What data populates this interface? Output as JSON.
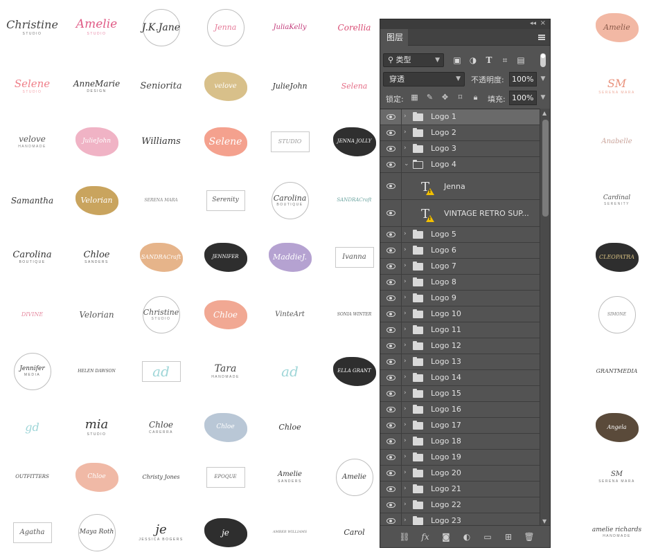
{
  "colors": {
    "panel_bg": "#535353",
    "panel_dark": "#3a3a3a",
    "selected_row": "#6a6a6a",
    "text": "#e3e3e3",
    "warning": "#f3c000"
  },
  "panel": {
    "tab_label": "图层",
    "filter": {
      "kind_label": "类型",
      "icons": [
        "image-filter-icon",
        "adjustment-filter-icon",
        "type-filter-icon",
        "shape-filter-icon",
        "smart-object-filter-icon"
      ]
    },
    "blend_mode": "穿透",
    "opacity_label": "不透明度:",
    "opacity_value": "100%",
    "lock_label": "锁定:",
    "fill_label": "填充:",
    "fill_value": "100%",
    "layers": [
      {
        "name": "Logo 1",
        "kind": "group",
        "expanded": false,
        "selected": true
      },
      {
        "name": "Logo 2",
        "kind": "group",
        "expanded": false
      },
      {
        "name": "Logo 3",
        "kind": "group",
        "expanded": false
      },
      {
        "name": "Logo 4",
        "kind": "group",
        "expanded": true
      },
      {
        "name": "Jenna",
        "kind": "text",
        "warning": true
      },
      {
        "name": "VINTAGE RETRO SUP...",
        "kind": "text",
        "warning": true
      },
      {
        "name": "Logo 5",
        "kind": "group",
        "expanded": false
      },
      {
        "name": "Logo 6",
        "kind": "group",
        "expanded": false
      },
      {
        "name": "Logo 7",
        "kind": "group",
        "expanded": false
      },
      {
        "name": "Logo 8",
        "kind": "group",
        "expanded": false
      },
      {
        "name": "Logo 9",
        "kind": "group",
        "expanded": false
      },
      {
        "name": "Logo 10",
        "kind": "group",
        "expanded": false
      },
      {
        "name": "Logo 11",
        "kind": "group",
        "expanded": false
      },
      {
        "name": "Logo 12",
        "kind": "group",
        "expanded": false
      },
      {
        "name": "Logo 13",
        "kind": "group",
        "expanded": false
      },
      {
        "name": "Logo 14",
        "kind": "group",
        "expanded": false
      },
      {
        "name": "Logo 15",
        "kind": "group",
        "expanded": false
      },
      {
        "name": "Logo 16",
        "kind": "group",
        "expanded": false
      },
      {
        "name": "Logo 17",
        "kind": "group",
        "expanded": false
      },
      {
        "name": "Logo 18",
        "kind": "group",
        "expanded": false
      },
      {
        "name": "Logo 19",
        "kind": "group",
        "expanded": false
      },
      {
        "name": "Logo 20",
        "kind": "group",
        "expanded": false
      },
      {
        "name": "Logo 21",
        "kind": "group",
        "expanded": false
      },
      {
        "name": "Logo 22",
        "kind": "group",
        "expanded": false
      },
      {
        "name": "Logo 23",
        "kind": "group",
        "expanded": false
      }
    ],
    "footer_buttons": [
      "link-layers-icon",
      "fx-icon",
      "add-mask-icon",
      "adjustment-layer-icon",
      "new-group-icon",
      "new-layer-icon",
      "trash-icon"
    ]
  },
  "logos": [
    {
      "text": "Christine",
      "sub": "STUDIO",
      "color": "#444444",
      "size": 16,
      "row": 0,
      "col": 0
    },
    {
      "text": "Amelie",
      "sub": "STUDIO",
      "color": "#e05b86",
      "size": 17,
      "row": 0,
      "col": 1
    },
    {
      "text": "J.K.Jane",
      "sub": "",
      "color": "#333333",
      "size": 14,
      "row": 0,
      "col": 2,
      "ring": true
    },
    {
      "text": "Jenna",
      "sub": "",
      "color": "#e57a98",
      "size": 11,
      "row": 0,
      "col": 3,
      "ring": true
    },
    {
      "text": "JuliaKelly",
      "sub": "",
      "color": "#c23b7a",
      "size": 10,
      "row": 0,
      "col": 4
    },
    {
      "text": "Corellia",
      "sub": "",
      "color": "#d94b73",
      "size": 12,
      "row": 0,
      "col": 5
    },
    {
      "text": "Amelie",
      "sub": "",
      "color": "#8a5a4a",
      "size": 11,
      "row": 0,
      "col": 9,
      "blob": "#f2b8a4"
    },
    {
      "text": "Selene",
      "sub": "STUDIO",
      "color": "#ef7e88",
      "size": 15,
      "row": 1,
      "col": 0
    },
    {
      "text": "AnneMarie",
      "sub": "DESIGN",
      "color": "#333333",
      "size": 12,
      "row": 1,
      "col": 1
    },
    {
      "text": "Seniorita",
      "sub": "",
      "color": "#444444",
      "size": 13,
      "row": 1,
      "col": 2
    },
    {
      "text": "velove",
      "sub": "",
      "color": "#ffffff",
      "size": 10,
      "row": 1,
      "col": 3,
      "blob": "#d8c08a"
    },
    {
      "text": "JulieJohn",
      "sub": "",
      "color": "#333333",
      "size": 11,
      "row": 1,
      "col": 4
    },
    {
      "text": "Selena",
      "sub": "",
      "color": "#e56d86",
      "size": 11,
      "row": 1,
      "col": 5
    },
    {
      "text": "SM",
      "sub": "SERENA MARA",
      "color": "#e9927d",
      "size": 16,
      "row": 1,
      "col": 9
    },
    {
      "text": "velove",
      "sub": "HANDMADE",
      "color": "#555555",
      "size": 12,
      "row": 2,
      "col": 0
    },
    {
      "text": "JulieJohn",
      "sub": "",
      "color": "#ffffff",
      "size": 9,
      "row": 2,
      "col": 1,
      "blob": "#f0b3c5"
    },
    {
      "text": "Williams",
      "sub": "",
      "color": "#333333",
      "size": 13,
      "row": 2,
      "col": 2
    },
    {
      "text": "Selene",
      "sub": "",
      "color": "#ffffff",
      "size": 14,
      "row": 2,
      "col": 3,
      "blob": "#f4a18e"
    },
    {
      "text": "STUDIO",
      "sub": "",
      "color": "#9a9a9a",
      "size": 8,
      "row": 2,
      "col": 4,
      "box": true
    },
    {
      "text": "JENNA JOLLY",
      "sub": "",
      "color": "#ffffff",
      "size": 7,
      "row": 2,
      "col": 5,
      "blob": "#2f2f2f"
    },
    {
      "text": "Anabelle",
      "sub": "",
      "color": "#c9a39a",
      "size": 10,
      "row": 2,
      "col": 9
    },
    {
      "text": "Samantha",
      "sub": "",
      "color": "#333333",
      "size": 12,
      "row": 3,
      "col": 0
    },
    {
      "text": "Velorian",
      "sub": "",
      "color": "#ffffff",
      "size": 11,
      "row": 3,
      "col": 1,
      "blob": "#c9a45e"
    },
    {
      "text": "SERENA MARA",
      "sub": "",
      "color": "#7a7a7a",
      "size": 6,
      "row": 3,
      "col": 2
    },
    {
      "text": "Serenity",
      "sub": "",
      "color": "#555555",
      "size": 9,
      "row": 3,
      "col": 3,
      "box": true
    },
    {
      "text": "Carolina",
      "sub": "BOUTIQUE",
      "color": "#444444",
      "size": 11,
      "row": 3,
      "col": 4,
      "ring": true
    },
    {
      "text": "SANDRACraft",
      "sub": "",
      "color": "#6aa39f",
      "size": 7,
      "row": 3,
      "col": 5
    },
    {
      "text": "Cardinal",
      "sub": "SERENITY",
      "color": "#555555",
      "size": 9,
      "row": 3,
      "col": 9
    },
    {
      "text": "Carolina",
      "sub": "BOUTIQUE",
      "color": "#333333",
      "size": 13,
      "row": 4,
      "col": 0
    },
    {
      "text": "Chloe",
      "sub": "SANDERS",
      "color": "#333333",
      "size": 13,
      "row": 4,
      "col": 1
    },
    {
      "text": "SANDRACraft",
      "sub": "",
      "color": "#ffffff",
      "size": 8,
      "row": 4,
      "col": 2,
      "blob": "#e6b48a"
    },
    {
      "text": "JENNIFER",
      "sub": "",
      "color": "#ffffff",
      "size": 7,
      "row": 4,
      "col": 3,
      "blob": "#2e2e2e"
    },
    {
      "text": "MaddieJ.",
      "sub": "",
      "color": "#ffffff",
      "size": 11,
      "row": 4,
      "col": 4,
      "blob": "#b5a2d1"
    },
    {
      "text": "Ivanna",
      "sub": "",
      "color": "#555555",
      "size": 10,
      "row": 4,
      "col": 5,
      "box": true
    },
    {
      "text": "CLEOPATRA",
      "sub": "",
      "color": "#d8c182",
      "size": 8,
      "row": 4,
      "col": 9,
      "blob": "#2e2e2e"
    },
    {
      "text": "DIVINE",
      "sub": "",
      "color": "#e58aa0",
      "size": 8,
      "row": 5,
      "col": 0
    },
    {
      "text": "Velorian",
      "sub": "",
      "color": "#555555",
      "size": 12,
      "row": 5,
      "col": 1
    },
    {
      "text": "Christine",
      "sub": "STUDIO",
      "color": "#555555",
      "size": 11,
      "row": 5,
      "col": 2,
      "ring": true
    },
    {
      "text": "Chloe",
      "sub": "",
      "color": "#ffffff",
      "size": 12,
      "row": 5,
      "col": 3,
      "blob": "#f1a893"
    },
    {
      "text": "VinteArt",
      "sub": "",
      "color": "#555555",
      "size": 10,
      "row": 5,
      "col": 4
    },
    {
      "text": "SONIA WINTER",
      "sub": "",
      "color": "#555555",
      "size": 6,
      "row": 5,
      "col": 5
    },
    {
      "text": "SIMONE",
      "sub": "",
      "color": "#777777",
      "size": 6,
      "row": 5,
      "col": 9,
      "ring": true
    },
    {
      "text": "Jennifer",
      "sub": "MEDIA",
      "color": "#333333",
      "size": 9,
      "row": 6,
      "col": 0,
      "ring": true
    },
    {
      "text": "HELEN DAWSON",
      "sub": "",
      "color": "#444444",
      "size": 6,
      "row": 6,
      "col": 1
    },
    {
      "text": "ad",
      "sub": "",
      "color": "#9fd6d8",
      "size": 20,
      "row": 6,
      "col": 2,
      "box": true
    },
    {
      "text": "Tara",
      "sub": "HANDMADE",
      "color": "#444444",
      "size": 14,
      "row": 6,
      "col": 3
    },
    {
      "text": "ad",
      "sub": "",
      "color": "#9fd6d8",
      "size": 20,
      "row": 6,
      "col": 4
    },
    {
      "text": "ELLA GRANT",
      "sub": "",
      "color": "#ffffff",
      "size": 7,
      "row": 6,
      "col": 5,
      "blob": "#2e2e2e"
    },
    {
      "text": "GRANTMEDIA",
      "sub": "",
      "color": "#444444",
      "size": 8,
      "row": 6,
      "col": 9
    },
    {
      "text": "gd",
      "sub": "",
      "color": "#9fd6d8",
      "size": 16,
      "row": 7,
      "col": 0
    },
    {
      "text": "mia",
      "sub": "STUDIO",
      "color": "#333333",
      "size": 18,
      "row": 7,
      "col": 1
    },
    {
      "text": "Chloe",
      "sub": "CARERRA",
      "color": "#444444",
      "size": 12,
      "row": 7,
      "col": 2
    },
    {
      "text": "Chloe",
      "sub": "",
      "color": "#ffffff",
      "size": 9,
      "row": 7,
      "col": 3,
      "blob": "#b9c7d6"
    },
    {
      "text": "Chloe",
      "sub": "",
      "color": "#333333",
      "size": 11,
      "row": 7,
      "col": 4
    },
    {
      "text": "Angela",
      "sub": "",
      "color": "#ffffff",
      "size": 8,
      "row": 7,
      "col": 9,
      "blob": "#5a4a3a"
    },
    {
      "text": "OUTFITTERS",
      "sub": "",
      "color": "#444444",
      "size": 7,
      "row": 8,
      "col": 0
    },
    {
      "text": "Chloe",
      "sub": "",
      "color": "#ffffff",
      "size": 9,
      "row": 8,
      "col": 1,
      "blob": "#f0b9a6"
    },
    {
      "text": "Christy Jones",
      "sub": "",
      "color": "#444444",
      "size": 8,
      "row": 8,
      "col": 2
    },
    {
      "text": "EPOQUE",
      "sub": "",
      "color": "#666666",
      "size": 7,
      "row": 8,
      "col": 3,
      "box": true
    },
    {
      "text": "Amelie",
      "sub": "SANDERS",
      "color": "#333333",
      "size": 10,
      "row": 8,
      "col": 4
    },
    {
      "text": "Amelie",
      "sub": "",
      "color": "#333333",
      "size": 10,
      "row": 8,
      "col": 5,
      "ring": true
    },
    {
      "text": "SM",
      "sub": "SERENA MARA",
      "color": "#444444",
      "size": 10,
      "row": 8,
      "col": 9
    },
    {
      "text": "Agatha",
      "sub": "",
      "color": "#555555",
      "size": 10,
      "row": 9,
      "col": 0,
      "box": true
    },
    {
      "text": "Maya Roth",
      "sub": "",
      "color": "#444444",
      "size": 9,
      "row": 9,
      "col": 1,
      "ring": true
    },
    {
      "text": "je",
      "sub": "JESSICA BOGERS",
      "color": "#333333",
      "size": 18,
      "row": 9,
      "col": 2
    },
    {
      "text": "je",
      "sub": "",
      "color": "#ffffff",
      "size": 12,
      "row": 9,
      "col": 3,
      "blob": "#2e2e2e"
    },
    {
      "text": "AMBER WILLIAMS",
      "sub": "",
      "color": "#777777",
      "size": 5,
      "row": 9,
      "col": 4
    },
    {
      "text": "Carol",
      "sub": "",
      "color": "#333333",
      "size": 11,
      "row": 9,
      "col": 5
    },
    {
      "text": "amelie richards",
      "sub": "HANDMADE",
      "color": "#444444",
      "size": 9,
      "row": 9,
      "col": 9
    }
  ]
}
